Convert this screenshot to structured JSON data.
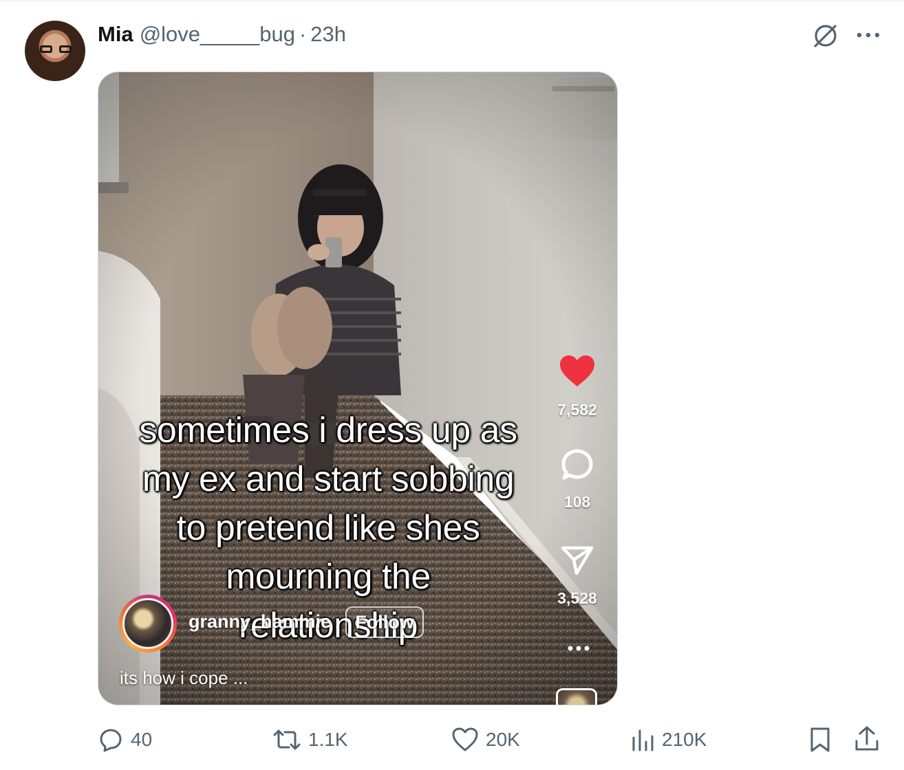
{
  "post": {
    "author_name": "Mia",
    "handle": "@love_____bug",
    "separator": "·",
    "time": "23h"
  },
  "media": {
    "overlay_lines": [
      "sometimes i dress up as",
      "my ex and start sobbing",
      "to pretend like shes",
      "mourning the",
      "relationship"
    ],
    "likes": "7,582",
    "comments": "108",
    "shares": "3,528",
    "creator": "granny_hammie",
    "follow_label": "Follow",
    "caption": "its how i cope ...",
    "heart_color": "#f0313f"
  },
  "actions": {
    "replies": "40",
    "reposts": "1.1K",
    "likes": "20K",
    "views": "210K"
  },
  "icons": [
    "grok-icon",
    "more-icon",
    "reply-icon",
    "repost-icon",
    "like-icon",
    "views-icon",
    "bookmark-icon",
    "share-icon"
  ],
  "colors": {
    "muted": "#536471",
    "text": "#0f1419",
    "border": "#cfd9de"
  }
}
